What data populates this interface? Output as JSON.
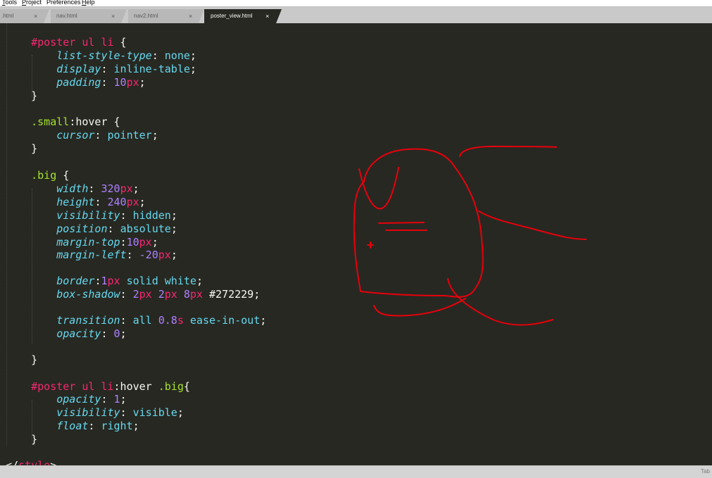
{
  "menu": [
    {
      "key": "T",
      "rest": "ools"
    },
    {
      "key": "P",
      "rest": "roject"
    },
    {
      "key": "",
      "rest": "Preferences"
    },
    {
      "key": "H",
      "rest": "elp"
    }
  ],
  "tabs": [
    {
      "label": ".html"
    },
    {
      "label": "nav.html"
    },
    {
      "label": "nav2.html"
    },
    {
      "label": "poster_view.html"
    }
  ],
  "close_glyph": "×",
  "code": {
    "l1": {
      "a": "#poster ul li",
      "b": " {"
    },
    "l2": {
      "p": "list-style-type",
      "c": ": ",
      "v": "none",
      "e": ";"
    },
    "l3": {
      "p": "display",
      "c": ": ",
      "v": "inline-table",
      "e": ";"
    },
    "l4": {
      "p": "padding",
      "c": ": ",
      "n": "10",
      "u": "px",
      "e": ";"
    },
    "l5": {
      "t": "}"
    },
    "l6": {
      "a": ".small",
      "h": ":hover",
      "b": " {"
    },
    "l7": {
      "p": "cursor",
      "c": ": ",
      "v": "pointer",
      "e": ";"
    },
    "l8": {
      "t": "}"
    },
    "l9": {
      "a": ".big",
      "b": " {"
    },
    "l10": {
      "p": "width",
      "c": ": ",
      "n": "320",
      "u": "px",
      "e": ";"
    },
    "l11": {
      "p": "height",
      "c": ": ",
      "n": "240",
      "u": "px",
      "e": ";"
    },
    "l12": {
      "p": "visibility",
      "c": ": ",
      "v": "hidden",
      "e": ";"
    },
    "l13": {
      "p": "position",
      "c": ": ",
      "v": "absolute",
      "e": ";"
    },
    "l14": {
      "p": "margin-top",
      "c": ":",
      "n": "10",
      "u": "px",
      "e": ";"
    },
    "l15": {
      "p": "margin-left",
      "c": ": ",
      "n": "-20",
      "u": "px",
      "e": ";"
    },
    "l16": {
      "p": "border",
      "c": ":",
      "n": "1",
      "u": "px",
      "v": " solid white",
      "e": ";"
    },
    "l17": {
      "p": "box-shadow",
      "c": ": ",
      "n1": "2",
      "u1": "px",
      "n2": " 2",
      "u2": "px",
      "n3": " 8",
      "u3": "px",
      "v": " #272229",
      "e": ";"
    },
    "l18": {
      "p": "transition",
      "c": ": ",
      "v1": "all ",
      "n": "0.8",
      "u": "s",
      "v2": " ease-in-out",
      "e": ";"
    },
    "l19": {
      "p": "opacity",
      "c": ": ",
      "n": "0",
      "e": ";"
    },
    "l20": {
      "t": "}"
    },
    "l21": {
      "a": "#poster ul li",
      "h": ":hover ",
      "g": ".big",
      "b": "{"
    },
    "l22": {
      "p": "opacity",
      "c": ": ",
      "n": "1",
      "e": ";"
    },
    "l23": {
      "p": "visibility",
      "c": ": ",
      "v": "visible",
      "e": ";"
    },
    "l24": {
      "p": "float",
      "c": ": ",
      "v": "right",
      "e": ";"
    },
    "l25": {
      "t": "}"
    },
    "l26": {
      "o": "</",
      "tg": "style",
      "x": ">"
    }
  },
  "status": {
    "tab_size": "Tab"
  },
  "colors": {
    "annotation": "#e8000b",
    "background": "#272822"
  }
}
